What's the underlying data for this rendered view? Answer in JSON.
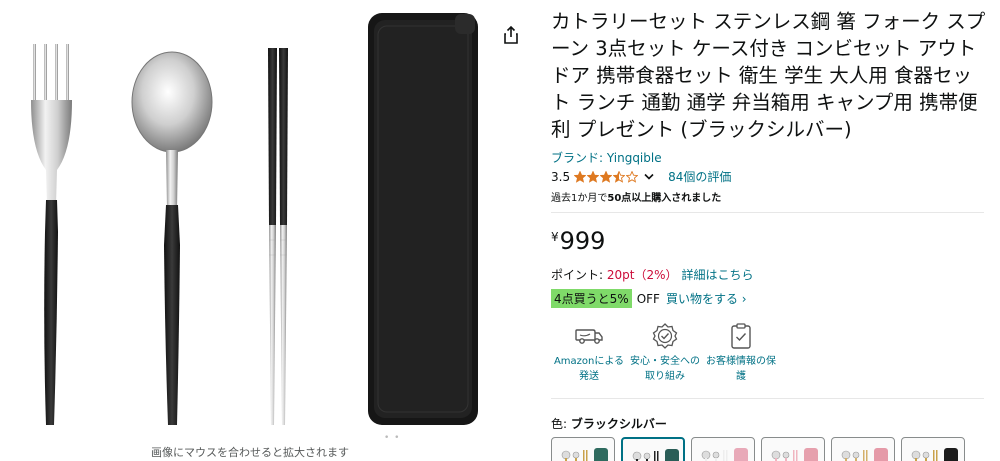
{
  "gallery": {
    "zoom_hint": "画像にマウスを合わせると拡大されます",
    "dots": "• •",
    "share_icon": "share-icon"
  },
  "product": {
    "title": "カトラリーセット ステンレス鋼 箸 フォーク スプーン 3点セット ケース付き コンビセット アウトドア 携帯食器セット 衛生 学生 大人用 食器セット ランチ 通勤 通学 弁当箱用 キャンプ用 携帯便利 プレゼント (ブラックシルバー)",
    "brand": "ブランド: Yingqible",
    "rating": {
      "value": "3.5",
      "stars": 3.5,
      "review_count": "84個の評価",
      "star_color": "#de7921"
    },
    "bought_prefix": "過去1か月で",
    "bought_bold": "50点以上購入されました",
    "price": {
      "currency": "¥",
      "amount": "999"
    },
    "points": {
      "label": "ポイント: ",
      "value": "20pt（2%）",
      "link": "詳細はこちら"
    },
    "promo": {
      "badge": "4点買うと5%",
      "off": "OFF",
      "link": "買い物をする ›"
    },
    "features": [
      {
        "icon": "delivery-truck-icon",
        "line1": "Amazonによる",
        "line2": "発送"
      },
      {
        "icon": "safety-badge-icon",
        "line1": "安心・安全への",
        "line2": "取り組み"
      },
      {
        "icon": "secure-document-icon",
        "line1": "お客様情報の保",
        "line2": "護"
      }
    ],
    "color": {
      "label": "色: ",
      "selected": "ブラックシルバー",
      "swatches": [
        {
          "name": "black-gold-green",
          "case_color": "#2f6b5f",
          "handle_color": "#c9a24a"
        },
        {
          "name": "black-silver-green",
          "case_color": "#2a5d57",
          "handle_color": "#222"
        },
        {
          "name": "white-silver-pink",
          "case_color": "#e8a9b8",
          "handle_color": "#eee"
        },
        {
          "name": "pink-silver",
          "case_color": "#e6a0ad",
          "handle_color": "#f0b5c0"
        },
        {
          "name": "white-gold-pink",
          "case_color": "#e59aa8",
          "handle_color": "#d4b06a"
        },
        {
          "name": "black-gold-black",
          "case_color": "#1c1c1c",
          "handle_color": "#c9a24a"
        }
      ]
    }
  }
}
